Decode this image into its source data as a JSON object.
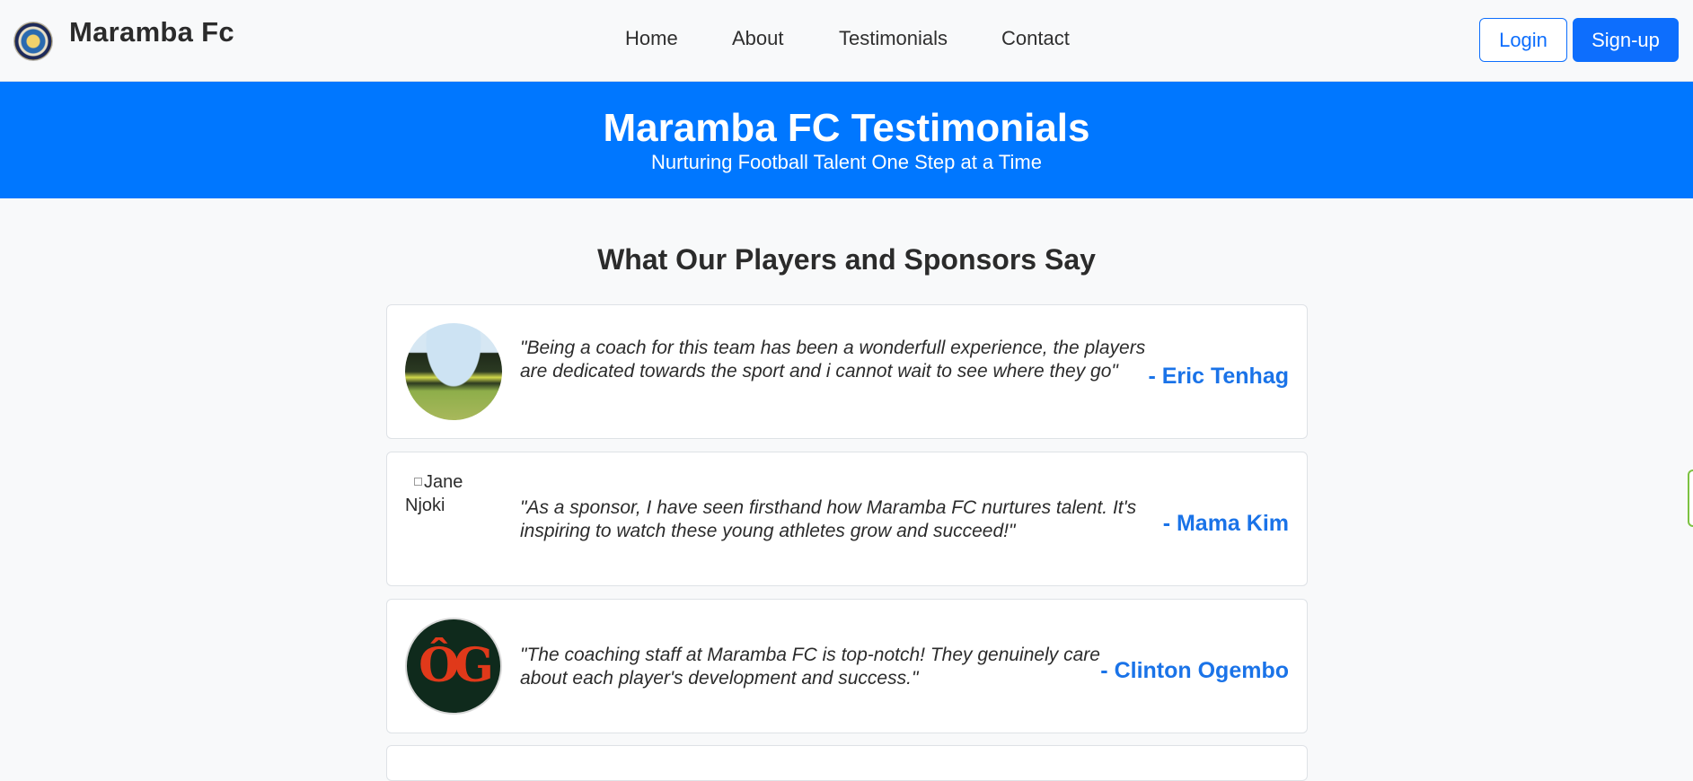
{
  "navbar": {
    "brand": "Maramba Fc",
    "logo_icon": "club-crest-icon",
    "links": [
      "Home",
      "About",
      "Testimonials",
      "Contact"
    ],
    "login_label": "Login",
    "signup_label": "Sign-up"
  },
  "hero": {
    "title": "Maramba FC Testimonials",
    "subtitle": "Nurturing Football Talent One Step at a Time"
  },
  "section": {
    "title": "What Our Players and Sponsors Say"
  },
  "testimonials": [
    {
      "quote": "\"Being a coach for this team has been a wonderfull experience, the players are dedicated towards the sport and i cannot wait to see where they go\"",
      "author": "- Eric Tenhag",
      "avatar": "team-photo"
    },
    {
      "quote": "\"As a sponsor, I have seen firsthand how Maramba FC nurtures talent. It's inspiring to watch these young athletes grow and succeed!\"",
      "author": "- Mama Kim",
      "avatar_alt": "Jane Njoki"
    },
    {
      "quote": "\"The coaching staff at Maramba FC is top-notch! They genuinely care about each player's development and success.\"",
      "author": "- Clinton Ogembo",
      "avatar_logo_text": "ÔG"
    }
  ],
  "colors": {
    "primary": "#0d6efd",
    "hero_bg": "#0077ff",
    "author": "#1a73e8"
  }
}
